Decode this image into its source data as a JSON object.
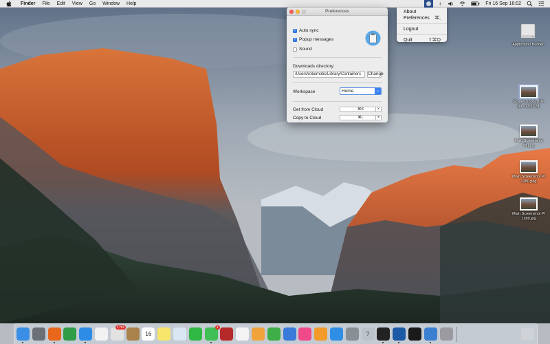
{
  "menubar": {
    "app_name": "Finder",
    "menus": [
      "File",
      "Edit",
      "View",
      "Go",
      "Window",
      "Help"
    ],
    "clock": "Fri 16 Sep  16:02",
    "icons": [
      "apple-logo",
      "app-status-icon",
      "volume-icon",
      "wifi-icon",
      "battery-icon",
      "spotlight-icon",
      "notification-center-icon"
    ]
  },
  "status_menu": {
    "items": [
      {
        "label": "About",
        "shortcut": ""
      },
      {
        "label": "Preferences",
        "shortcut": "⌘,"
      },
      {
        "label": "Logout",
        "shortcut": ""
      },
      {
        "label": "Quit",
        "shortcut": "⇧⌘Q"
      }
    ]
  },
  "prefs": {
    "title": "Preferences",
    "checkboxes": [
      {
        "label": "Auto sync",
        "checked": true
      },
      {
        "label": "Popup messages",
        "checked": true
      },
      {
        "label": "Sound",
        "checked": false
      }
    ],
    "downloads_label": "Downloads directory:",
    "downloads_path": "/Users/robomotic/Library/Containers",
    "change_button": "Change",
    "workspace_label": "Workspace",
    "workspace_value": "Home",
    "get_label": "Get from Cloud",
    "get_shortcut": "⌘K",
    "copy_label": "Copy to Cloud",
    "copy_shortcut": "⌘L",
    "clear": "×"
  },
  "desktop": {
    "icons": [
      {
        "label": "Application Builder"
      },
      {
        "label": "Screen Shot 2016-09...13.27.31"
      },
      {
        "label": "Main Screenshot Pl.png"
      },
      {
        "label": "Main Screenshot Pl 1280.png"
      },
      {
        "label": "Main Screenshot Pl 1280.jpg"
      }
    ]
  },
  "dock": {
    "apps": [
      {
        "name": "finder-icon",
        "color": "#3a8ee6"
      },
      {
        "name": "launchpad-icon",
        "color": "#6b6f78"
      },
      {
        "name": "firefox-icon",
        "color": "#e8671b"
      },
      {
        "name": "chrome-icon",
        "color": "#2f9c48"
      },
      {
        "name": "safari-icon",
        "color": "#2d8ce6"
      },
      {
        "name": "photos-grid-icon",
        "color": "#f2f2f2"
      },
      {
        "name": "calendar-badge-icon",
        "color": "#e2e2e2",
        "badge": "1,764"
      },
      {
        "name": "notes-brown-icon",
        "color": "#a9824b"
      },
      {
        "name": "calendar-icon",
        "color": "#ffffff",
        "text": "16"
      },
      {
        "name": "stickies-icon",
        "color": "#f6e56a"
      },
      {
        "name": "preview-icon",
        "color": "#d9e6f3"
      },
      {
        "name": "facetime-icon",
        "color": "#2fb944"
      },
      {
        "name": "messages-icon",
        "color": "#3fbf55",
        "badge": "1"
      },
      {
        "name": "photo-booth-icon",
        "color": "#b62a2a"
      },
      {
        "name": "photos-icon",
        "color": "#f4f4f4"
      },
      {
        "name": "pages-icon",
        "color": "#f2a23b"
      },
      {
        "name": "numbers-icon",
        "color": "#3fae49"
      },
      {
        "name": "keynote-icon",
        "color": "#3a7ad8"
      },
      {
        "name": "itunes-icon",
        "color": "#f04a8a"
      },
      {
        "name": "ibooks-icon",
        "color": "#f29a2a"
      },
      {
        "name": "app-store-icon",
        "color": "#2f8ee6"
      },
      {
        "name": "system-preferences-icon",
        "color": "#8a8f96"
      },
      {
        "name": "help-icon",
        "color": "#bcc2ca",
        "text": "?"
      },
      {
        "name": "terminal-icon",
        "color": "#222222"
      },
      {
        "name": "virtualbox-icon",
        "color": "#1d5aa6"
      },
      {
        "name": "activity-monitor-icon",
        "color": "#1a1a1a"
      },
      {
        "name": "xcode-icon",
        "color": "#3b7fd0"
      },
      {
        "name": "archive-utility-icon",
        "color": "#9a9aa0"
      },
      {
        "name": "trash-icon",
        "color": "#cfd3d8"
      }
    ]
  }
}
